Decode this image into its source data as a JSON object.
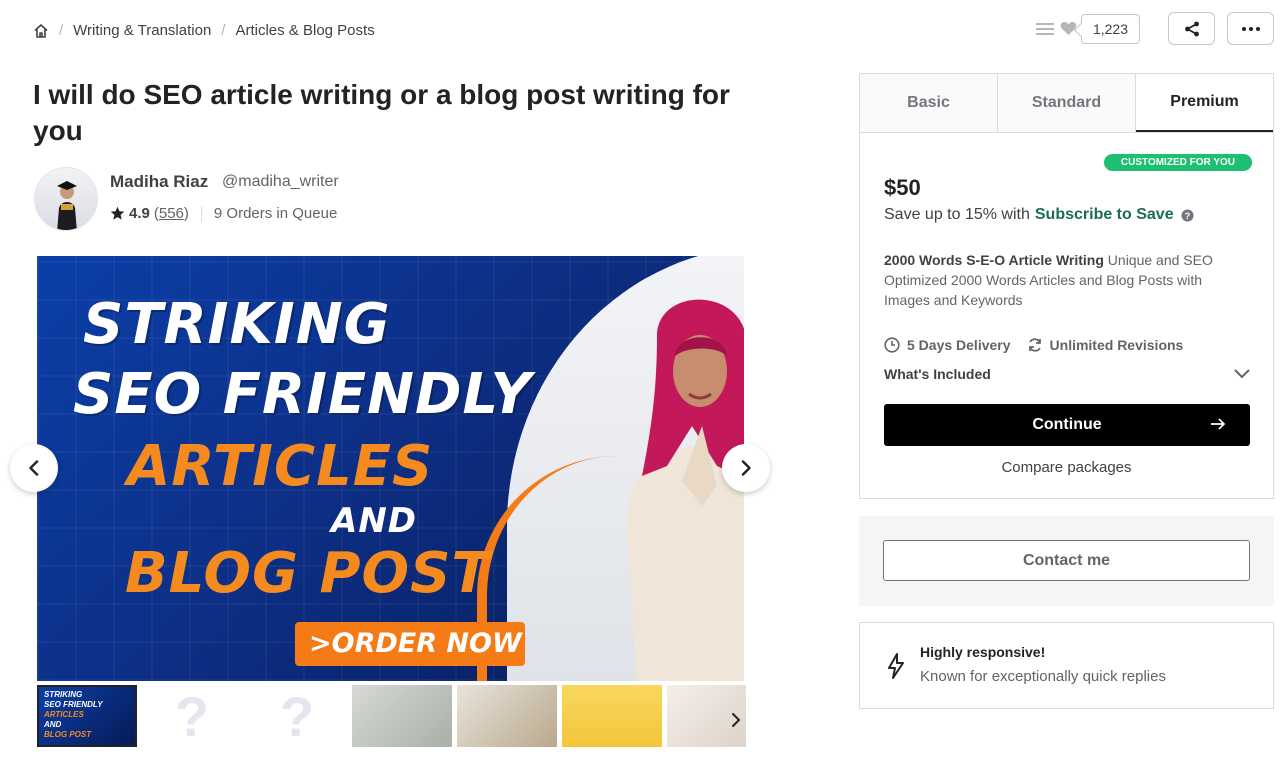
{
  "breadcrumb": {
    "home_icon": "home-icon",
    "items": [
      "Writing & Translation",
      "Articles & Blog Posts"
    ],
    "separator": "/"
  },
  "actions": {
    "save_count": "1,223",
    "icons": [
      "menu-lines-icon",
      "heart-icon",
      "share-icon",
      "more-icon"
    ]
  },
  "gig": {
    "title": "I will do SEO article writing or a blog post writing for you"
  },
  "seller": {
    "name": "Madiha Riaz",
    "handle": "@madiha_writer",
    "rating": "4.9",
    "reviews_open": "(",
    "reviews": "556",
    "reviews_close": ")",
    "queue": "9 Orders in Queue"
  },
  "gallery": {
    "hero_lines": [
      "STRIKING",
      "SEO FRIENDLY",
      "ARTICLES",
      "AND",
      "BLOG POST"
    ],
    "order_button": ">ORDER NOW",
    "thumb_lines": [
      "STRIKING",
      "SEO FRIENDLY",
      "ARTICLES",
      "AND",
      "BLOG POST"
    ],
    "placeholder_glyph": "?",
    "accent_orange": "#f58a1f",
    "hero_blue": "#0b3fa8"
  },
  "package": {
    "tabs": [
      "Basic",
      "Standard",
      "Premium"
    ],
    "active_tab": "Premium",
    "badge": "CUSTOMIZED FOR YOU",
    "price": "$50",
    "save_prefix": "Save up to 15% with",
    "save_link": "Subscribe to Save",
    "desc_bold": "2000 Words S-E-O Article Writing",
    "desc_rest": " Unique and SEO Optimized 2000 Words Articles and Blog Posts with Images and Keywords",
    "delivery": "5 Days Delivery",
    "revisions": "Unlimited Revisions",
    "included": "What's Included",
    "continue": "Continue",
    "compare": "Compare packages",
    "accent_green": "#1dbf73"
  },
  "contact": {
    "button": "Contact me"
  },
  "responsive": {
    "title": "Highly responsive!",
    "text": "Known for exceptionally quick replies"
  }
}
